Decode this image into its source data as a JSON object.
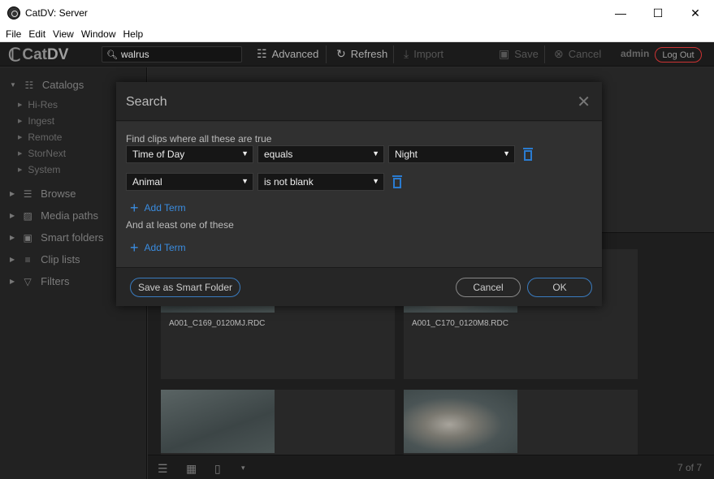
{
  "window": {
    "title": "CatDV: Server",
    "minimize": "—",
    "maximize": "☐",
    "close": "✕"
  },
  "menu": [
    "File",
    "Edit",
    "View",
    "Window",
    "Help"
  ],
  "toolbar": {
    "logo_cat": "Cat",
    "logo_dv": "DV",
    "search_value": "walrus",
    "advanced": "Advanced",
    "refresh": "Refresh",
    "import": "Import",
    "save": "Save",
    "cancel": "Cancel",
    "user": "admin",
    "logout": "Log Out"
  },
  "sidebar": {
    "catalogs": "Catalogs",
    "catalog_items": [
      "Hi-Res",
      "Ingest",
      "Remote",
      "StorNext",
      "System"
    ],
    "sections": [
      "Browse",
      "Media paths",
      "Smart folders",
      "Clip lists",
      "Filters"
    ]
  },
  "clips": [
    {
      "name": "A001_C169_0120MJ.RDC"
    },
    {
      "name": "A001_C170_0120M8.RDC"
    }
  ],
  "footer": {
    "count": "7 of 7"
  },
  "dialog": {
    "title": "Search",
    "close": "✕",
    "all_label": "Find clips where all these are true",
    "terms": [
      {
        "field": "Time of Day",
        "operator": "equals",
        "value": "Night"
      },
      {
        "field": "Animal",
        "operator": "is not blank"
      }
    ],
    "add_term": "Add Term",
    "any_label": "And at least one of these",
    "save_smart": "Save as Smart Folder",
    "cancel": "Cancel",
    "ok": "OK"
  },
  "colors": {
    "accent": "#2a7bd0",
    "logout_border": "#cc3333"
  }
}
